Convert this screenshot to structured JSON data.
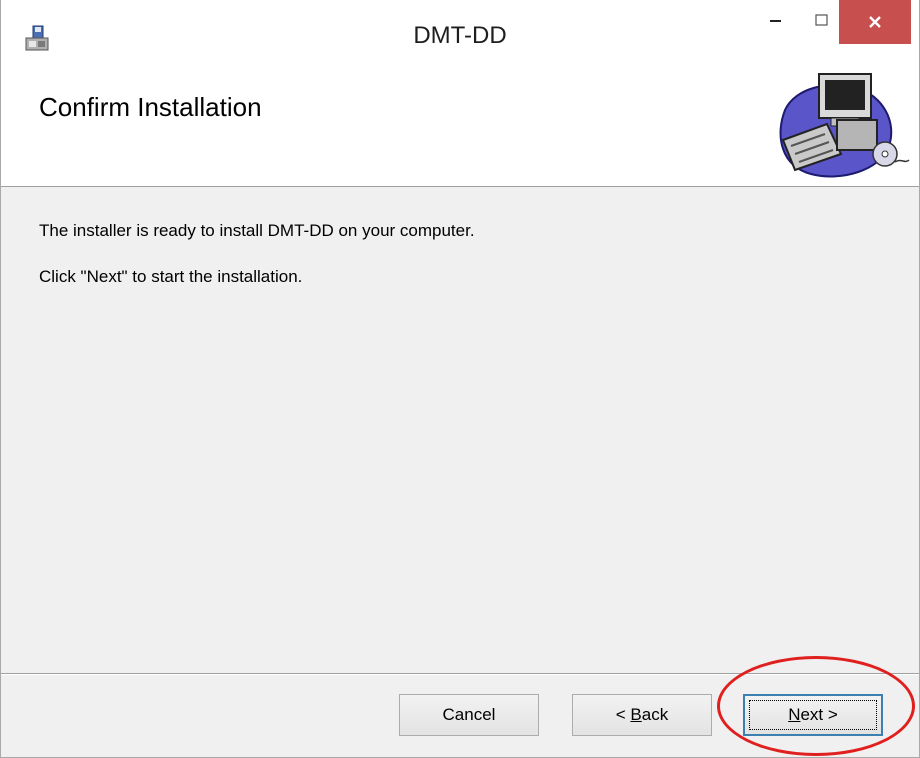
{
  "window": {
    "title": "DMT-DD"
  },
  "header": {
    "title": "Confirm Installation"
  },
  "body": {
    "line1": "The installer is ready to install DMT-DD on your computer.",
    "line2": "Click \"Next\" to start the installation."
  },
  "buttons": {
    "cancel": "Cancel",
    "back_prefix": "< ",
    "back_underlined": "B",
    "back_rest": "ack",
    "next_underlined": "N",
    "next_rest": "ext >"
  },
  "colors": {
    "close_button": "#c7504f",
    "highlight_circle": "#e0201e",
    "focus_border": "#3c7fb1"
  },
  "icons": [
    "installer-app-icon",
    "minimize-icon",
    "maximize-icon",
    "close-icon",
    "computer-illustration"
  ]
}
